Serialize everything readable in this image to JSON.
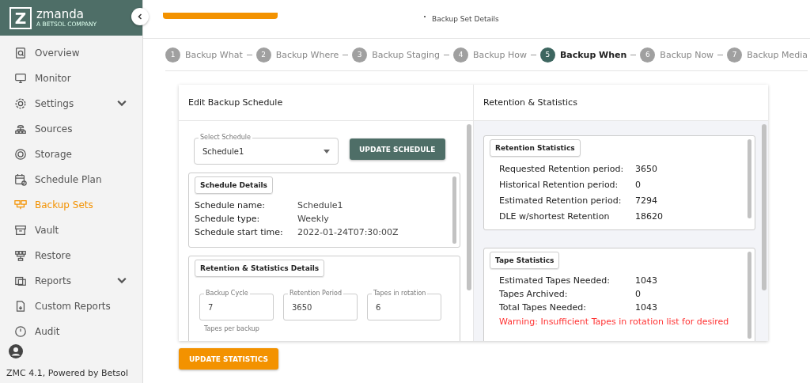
{
  "sidebar": {
    "logo": {
      "letter": "Z",
      "name": "zmanda",
      "tagline": "A BETSOL COMPANY"
    },
    "items": [
      {
        "label": "Overview",
        "selected": false,
        "expandable": false
      },
      {
        "label": "Monitor",
        "selected": false,
        "expandable": false
      },
      {
        "label": "Settings",
        "selected": false,
        "expandable": true
      },
      {
        "label": "Sources",
        "selected": false,
        "expandable": false
      },
      {
        "label": "Storage",
        "selected": false,
        "expandable": false
      },
      {
        "label": "Schedule Plan",
        "selected": false,
        "expandable": false
      },
      {
        "label": "Backup Sets",
        "selected": true,
        "expandable": false
      },
      {
        "label": "Vault",
        "selected": false,
        "expandable": false
      },
      {
        "label": "Restore",
        "selected": false,
        "expandable": false
      },
      {
        "label": "Reports",
        "selected": false,
        "expandable": true
      },
      {
        "label": "Custom Reports",
        "selected": false,
        "expandable": false
      },
      {
        "label": "Audit",
        "selected": false,
        "expandable": false
      }
    ],
    "footer": "ZMC 4.1, Powered by Betsol"
  },
  "header": {
    "title": "Backup Set Details"
  },
  "steps": [
    {
      "number": "1",
      "label": "Backup What",
      "selected": false
    },
    {
      "number": "2",
      "label": "Backup Where",
      "selected": false
    },
    {
      "number": "3",
      "label": "Backup Staging",
      "selected": false
    },
    {
      "number": "4",
      "label": "Backup How",
      "selected": false
    },
    {
      "number": "5",
      "label": "Backup When",
      "selected": true
    },
    {
      "number": "6",
      "label": "Backup Now",
      "selected": false
    },
    {
      "number": "7",
      "label": "Backup Media",
      "selected": false
    }
  ],
  "left_panel": {
    "title": "Edit Backup Schedule",
    "select": {
      "label": "Select Schedule",
      "value": "Schedule1"
    },
    "update_button": "UPDATE SCHEDULE",
    "schedule_details": {
      "title": "Schedule Details",
      "rows": [
        {
          "label": "Schedule name:",
          "value": "Schedule1"
        },
        {
          "label": "Schedule type:",
          "value": "Weekly"
        },
        {
          "label": "Schedule start time:",
          "value": "2022-01-24T07:30:00Z"
        }
      ]
    },
    "retention_details": {
      "title": "Retention & Statistics Details",
      "fields": [
        {
          "label": "Backup Cycle",
          "value": "7"
        },
        {
          "label": "Retention Period",
          "value": "3650"
        },
        {
          "label": "Tapes in rotation",
          "value": "6"
        }
      ],
      "next_label": "Tapes per backup"
    }
  },
  "right_panel": {
    "title": "Retention & Statistics",
    "retention_statistics": {
      "title": "Retention Statistics",
      "rows": [
        {
          "label": "Requested Retention period:",
          "value": "3650"
        },
        {
          "label": "Historical Retention period:",
          "value": "0"
        },
        {
          "label": "Estimated Retention period:",
          "value": "7294"
        },
        {
          "label": "DLE w/shortest Retention",
          "value": "18620"
        }
      ]
    },
    "tape_statistics": {
      "title": "Tape Statistics",
      "rows": [
        {
          "label": "Estimated Tapes Needed:",
          "value": "1043"
        },
        {
          "label": "Tapes Archived:",
          "value": "0"
        },
        {
          "label": "Total Tapes Needed:",
          "value": "1043"
        }
      ],
      "warning": "Warning: Insufficient Tapes in rotation list for desired"
    }
  },
  "update_statistics_button": "UPDATE STATISTICS"
}
